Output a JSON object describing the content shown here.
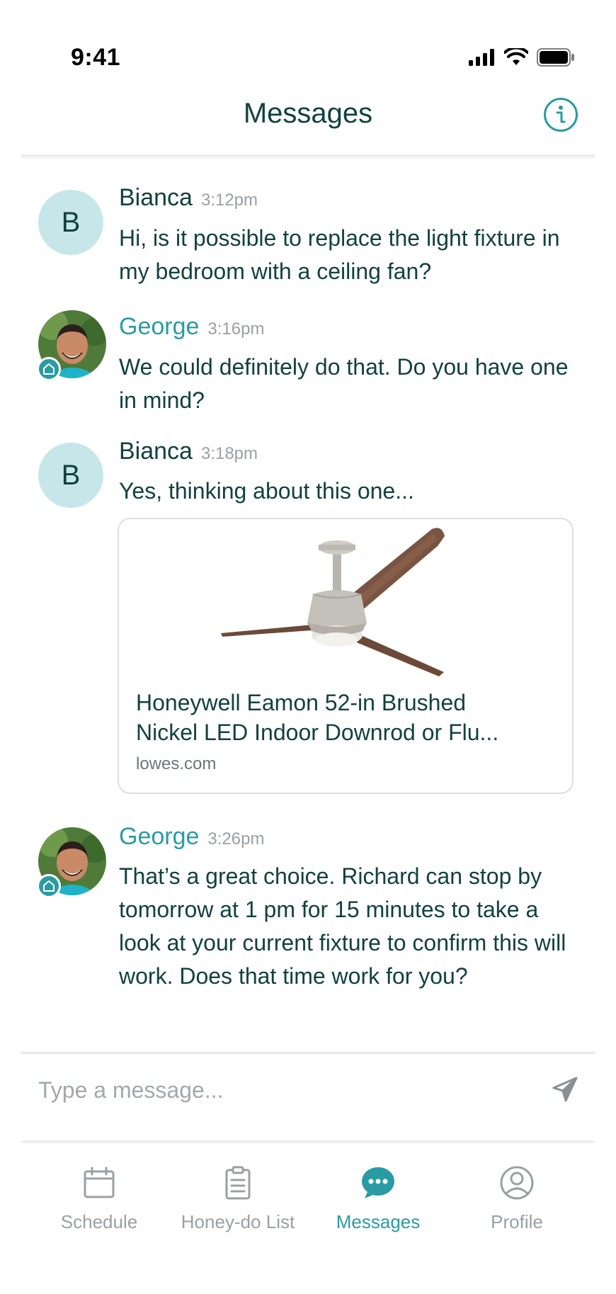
{
  "status_bar": {
    "time": "9:41",
    "icons": [
      "cellular-signal-icon",
      "wifi-icon",
      "battery-icon"
    ]
  },
  "header": {
    "title": "Messages",
    "info_icon": "info-icon"
  },
  "messages": [
    {
      "sender": "Bianca",
      "avatar_letter": "B",
      "time": "3:12pm",
      "text": "Hi, is it possible to replace the light fixture in my bedroom with a ceiling fan?"
    },
    {
      "sender": "George",
      "avatar": "george-photo",
      "badge_icon": "home-icon",
      "time": "3:16pm",
      "text": "We could definitely do that. Do you have one in mind?"
    },
    {
      "sender": "Bianca",
      "avatar_letter": "B",
      "time": "3:18pm",
      "text": "Yes, thinking about this one...",
      "link": {
        "title": "Honeywell Eamon 52-in Brushed\nNickel LED Indoor Downrod or Flu...",
        "domain": "lowes.com",
        "image": "ceiling-fan-image"
      }
    },
    {
      "sender": "George",
      "avatar": "george-photo",
      "badge_icon": "home-icon",
      "time": "3:26pm",
      "text": "That’s a great choice. Richard can stop by tomorrow at 1 pm for 15 minutes to take a look at your current fixture to confirm this will work. Does that time work for you?"
    }
  ],
  "composer": {
    "placeholder": "Type a message...",
    "send_icon": "send-icon"
  },
  "tabs": [
    {
      "label": "Schedule",
      "icon": "calendar-icon",
      "active": false
    },
    {
      "label": "Honey-do List",
      "icon": "clipboard-icon",
      "active": false
    },
    {
      "label": "Messages",
      "icon": "chat-bubble-icon",
      "active": true
    },
    {
      "label": "Profile",
      "icon": "user-circle-icon",
      "active": false
    }
  ],
  "colors": {
    "accent": "#2a9ba3",
    "text_dark": "#12413f",
    "avatar_bg": "#c6e6ea",
    "muted": "#9aa0a3"
  }
}
